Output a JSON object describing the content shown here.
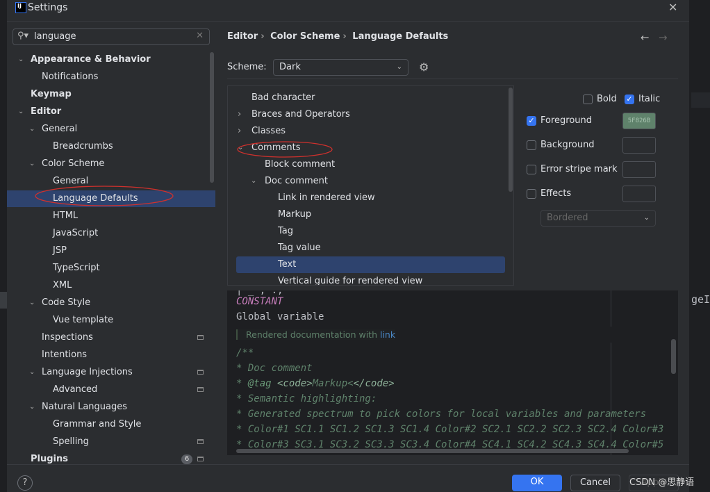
{
  "window": {
    "title": "Settings",
    "logo": "IJ"
  },
  "search": {
    "value": "language",
    "icon": "search-icon"
  },
  "sidebar": {
    "items": [
      {
        "label": "Appearance & Behavior",
        "level": 0,
        "expanded": true,
        "bold": true
      },
      {
        "label": "Notifications",
        "level": 1
      },
      {
        "label": "Keymap",
        "level": 0,
        "bold": true
      },
      {
        "label": "Editor",
        "level": 0,
        "expanded": true,
        "bold": true
      },
      {
        "label": "General",
        "level": 1,
        "expanded": true
      },
      {
        "label": "Breadcrumbs",
        "level": 2
      },
      {
        "label": "Color Scheme",
        "level": 1,
        "expanded": true
      },
      {
        "label": "General",
        "level": 2
      },
      {
        "label": "Language Defaults",
        "level": 2,
        "selected": true
      },
      {
        "label": "HTML",
        "level": 2
      },
      {
        "label": "JavaScript",
        "level": 2
      },
      {
        "label": "JSP",
        "level": 2
      },
      {
        "label": "TypeScript",
        "level": 2
      },
      {
        "label": "XML",
        "level": 2
      },
      {
        "label": "Code Style",
        "level": 1,
        "expanded": true
      },
      {
        "label": "Vue template",
        "level": 2
      },
      {
        "label": "Inspections",
        "level": 1,
        "project": true
      },
      {
        "label": "Intentions",
        "level": 1
      },
      {
        "label": "Language Injections",
        "level": 1,
        "expanded": true,
        "project": true
      },
      {
        "label": "Advanced",
        "level": 2,
        "project": true
      },
      {
        "label": "Natural Languages",
        "level": 1,
        "expanded": true
      },
      {
        "label": "Grammar and Style",
        "level": 2
      },
      {
        "label": "Spelling",
        "level": 2,
        "project": true
      },
      {
        "label": "Plugins",
        "level": 0,
        "bold": true,
        "badge": "6",
        "project": true
      }
    ]
  },
  "breadcrumb": [
    "Editor",
    "Color Scheme",
    "Language Defaults"
  ],
  "scheme": {
    "label": "Scheme:",
    "value": "Dark"
  },
  "attributes": {
    "items": [
      {
        "label": "Bad character",
        "level": 0
      },
      {
        "label": "Braces and Operators",
        "level": 0,
        "collapsed": true
      },
      {
        "label": "Classes",
        "level": 0,
        "collapsed": true
      },
      {
        "label": "Comments",
        "level": 0,
        "expanded": true
      },
      {
        "label": "Block comment",
        "level": 1
      },
      {
        "label": "Doc comment",
        "level": 1,
        "expanded": true
      },
      {
        "label": "Link in rendered view",
        "level": 2
      },
      {
        "label": "Markup",
        "level": 2
      },
      {
        "label": "Tag",
        "level": 2
      },
      {
        "label": "Tag value",
        "level": 2
      },
      {
        "label": "Text",
        "level": 2,
        "selected": true
      },
      {
        "label": "Vertical guide for rendered view",
        "level": 2
      }
    ]
  },
  "options": {
    "bold": {
      "label": "Bold",
      "checked": false
    },
    "italic": {
      "label": "Italic",
      "checked": true
    },
    "foreground": {
      "label": "Foreground",
      "checked": true,
      "color": "5F826B"
    },
    "background": {
      "label": "Background",
      "checked": false
    },
    "error_stripe": {
      "label": "Error stripe mark",
      "checked": false
    },
    "effects": {
      "label": "Effects",
      "checked": false,
      "style": "Bordered"
    }
  },
  "preview": {
    "constant": "CONSTANT",
    "global": "Global variable",
    "rendered": "Rendered documentation with ",
    "rendered_link": "link",
    "lines": [
      "/**",
      " * Doc comment"
    ],
    "tag_line": {
      "prefix": " * ",
      "tag": "@tag",
      "code_open": " <code>",
      "markup": "Markup<",
      "code_close": "</code>"
    },
    "more": [
      " * Semantic highlighting:",
      " * Generated spectrum to pick colors for local variables and parameters",
      " *  Color#1 SC1.1 SC1.2 SC1.3 SC1.4 Color#2 SC2.1 SC2.2 SC2.3 SC2.4 Color#3",
      " *  Color#3 SC3.1 SC3.2 SC3.3 SC3.4 Color#4 SC4.1 SC4.2 SC4.3 SC4.4 Color#5"
    ]
  },
  "buttons": {
    "ok": "OK",
    "cancel": "Cancel",
    "apply": "Apply",
    "help": "?"
  },
  "watermark": "CSDN @思静语",
  "background_text": "geI",
  "colors": {
    "accent": "#3574f0",
    "selection": "#2e436e",
    "annotation": "#d0312d",
    "doc_comment": "#5f826b"
  }
}
